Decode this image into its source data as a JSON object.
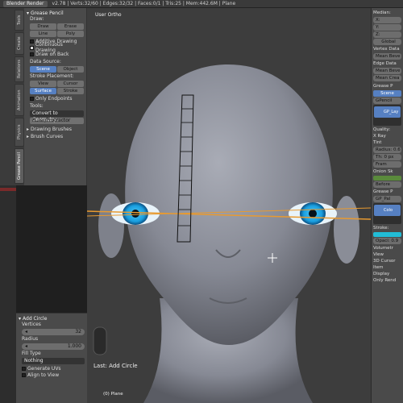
{
  "header": {
    "render_engine": "Blender Render",
    "stats": "v2.78 | Verts:32/60 | Edges:32/32 | Faces:0/1 | Tris:25 | Mem:442.6M | Plane"
  },
  "left_tabs": [
    "Tools",
    "Create",
    "Relations",
    "Animation",
    "Physics",
    "Grease Pencil"
  ],
  "tool_shelf": {
    "section_title": "Grease Pencil",
    "draw_label": "Draw:",
    "draw_buttons": [
      "Draw",
      "Erase",
      "Line",
      "Poly"
    ],
    "checks": [
      {
        "label": "Additive Drawing",
        "checked": false
      },
      {
        "label": "Continuous Drawing",
        "checked": true
      },
      {
        "label": "Draw on Back",
        "checked": false
      }
    ],
    "data_source_label": "Data Source:",
    "data_source": [
      "Scene",
      "Object"
    ],
    "stroke_placement_label": "Stroke Placement:",
    "placement_row1": [
      "View",
      "Cursor"
    ],
    "placement_row2": [
      "Surface",
      "Stroke"
    ],
    "only_endpoints": "Only Endpoints",
    "tools_label": "Tools:",
    "convert_select": "Convert to Geometry...",
    "ruler_button": "Ruler/Protractor",
    "collapsed": [
      "Drawing Brushes",
      "Brush Curves"
    ]
  },
  "redo_panel": {
    "title": "Add Circle",
    "vertices_label": "Vertices",
    "vertices_value": "32",
    "radius_label": "Radius",
    "radius_value": "1.000",
    "fill_type_label": "Fill Type",
    "fill_type_value": "Nothing",
    "checks": [
      "Generate UVs",
      "Align to View"
    ]
  },
  "viewport": {
    "label": "User Ortho",
    "last_op": "Last: Add Circle",
    "object": "(0) Plane"
  },
  "right_panel": {
    "median_label": "Median:",
    "axes": [
      "X:",
      "Y:",
      "Z:"
    ],
    "global_btn": "Global",
    "vertex_data": "Vertex Data",
    "mean_bevel": "Mean Beve",
    "edge_data": "Edge Data",
    "mean_bevel2": "Mean Beve",
    "mean_crease": "Mean Crea",
    "grease_title": "Grease P",
    "scene_btn": "Scene",
    "gp_block": "GPencil",
    "gp_layer": "GP_Lay",
    "quality": "Quality:",
    "xray": "X Ray",
    "tint": "Tint",
    "radius": "Radius: 0.6",
    "thickness": "Th: 0 px",
    "frame": "Fram",
    "onion": "Onion Sk",
    "before": "Before",
    "grease_palette": "Grease P",
    "gp_palette": "GP_Pal",
    "color": "Colo",
    "stroke": "Stroke:",
    "opacity": "Opaci: 0.9",
    "volumetric": "Volumetr",
    "view": "View",
    "cursor3d": "3D Cursor",
    "item": "Item",
    "display": "Display",
    "only_render": "Only Rend"
  }
}
